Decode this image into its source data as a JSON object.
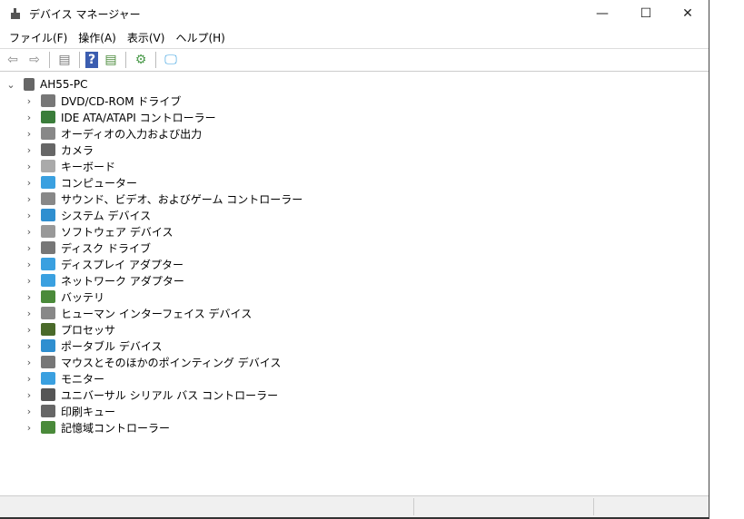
{
  "window": {
    "title": "デバイス マネージャー",
    "minimize": "—",
    "maximize": "☐",
    "close": "✕"
  },
  "menu": [
    {
      "label": "ファイル(F)"
    },
    {
      "label": "操作(A)"
    },
    {
      "label": "表示(V)"
    },
    {
      "label": "ヘルプ(H)"
    }
  ],
  "toolbar": {
    "back": "⇦",
    "forward": "⇨",
    "show_hide": "▤",
    "help": "?",
    "properties": "▤",
    "update": "⚙",
    "scan": "🖵"
  },
  "tree": {
    "root": "AH55-PC",
    "items": [
      {
        "label": "DVD/CD-ROM ドライブ",
        "color": "#777"
      },
      {
        "label": "IDE ATA/ATAPI コントローラー",
        "color": "#3a7d3a"
      },
      {
        "label": "オーディオの入力および出力",
        "color": "#888"
      },
      {
        "label": "カメラ",
        "color": "#666"
      },
      {
        "label": "キーボード",
        "color": "#aaa"
      },
      {
        "label": "コンピューター",
        "color": "#3aa0e0"
      },
      {
        "label": "サウンド、ビデオ、およびゲーム コントローラー",
        "color": "#888"
      },
      {
        "label": "システム デバイス",
        "color": "#2f8fd0"
      },
      {
        "label": "ソフトウェア デバイス",
        "color": "#999"
      },
      {
        "label": "ディスク ドライブ",
        "color": "#777"
      },
      {
        "label": "ディスプレイ アダプター",
        "color": "#3aa0e0"
      },
      {
        "label": "ネットワーク アダプター",
        "color": "#3aa0e0"
      },
      {
        "label": "バッテリ",
        "color": "#4a8a3a"
      },
      {
        "label": "ヒューマン インターフェイス デバイス",
        "color": "#888"
      },
      {
        "label": "プロセッサ",
        "color": "#4a6a2a"
      },
      {
        "label": "ポータブル デバイス",
        "color": "#2f8fd0"
      },
      {
        "label": "マウスとそのほかのポインティング デバイス",
        "color": "#777"
      },
      {
        "label": "モニター",
        "color": "#3aa0e0"
      },
      {
        "label": "ユニバーサル シリアル バス コントローラー",
        "color": "#555"
      },
      {
        "label": "印刷キュー",
        "color": "#666"
      },
      {
        "label": "記憶域コントローラー",
        "color": "#4a8a3a"
      }
    ]
  }
}
